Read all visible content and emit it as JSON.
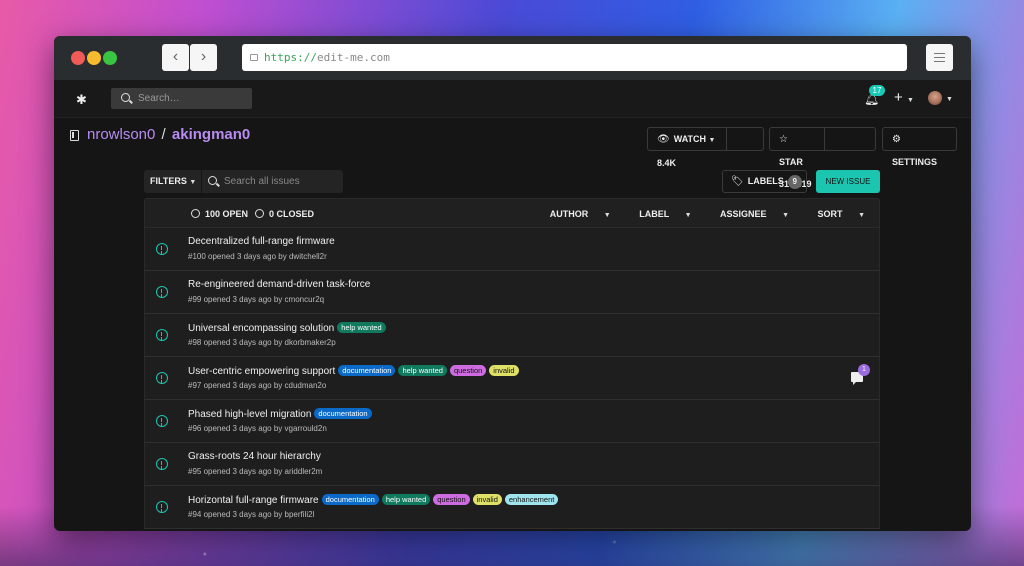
{
  "browser": {
    "url_protocol": "https://",
    "url_host": "edit-me.com",
    "back_glyph": "‹",
    "forward_glyph": "›"
  },
  "topnav": {
    "search_placeholder": "Search…",
    "notifications_count": "17",
    "plus": "+"
  },
  "repo": {
    "owner": "nrowlson0",
    "separator": "/",
    "name": "akingman0",
    "watch_label": "WATCH",
    "watch_count": "8.4K",
    "star_label": "STAR",
    "star_count": "316,419",
    "settings_label": "SETTINGS"
  },
  "toolbar": {
    "filters_label": "FILTERS",
    "search_placeholder": "Search all issues",
    "labels_label": "LABELS",
    "labels_count": "9",
    "new_issue_label": "NEW ISSUE"
  },
  "issues_header": {
    "open": "100 OPEN",
    "closed": "0 CLOSED",
    "author": "AUTHOR",
    "label": "LABEL",
    "assignee": "ASSIGNEE",
    "sort": "SORT"
  },
  "issues": [
    {
      "title": "Decentralized full-range firmware",
      "meta": "#100 opened 3 days ago by dwitchell2r",
      "labels": [],
      "comments": ""
    },
    {
      "title": "Re-engineered demand-driven task-force",
      "meta": "#99 opened 3 days ago by cmoncur2q",
      "labels": [],
      "comments": ""
    },
    {
      "title": "Universal encompassing solution",
      "meta": "#98 opened 3 days ago by dkorbmaker2p",
      "labels": [
        "help wanted"
      ],
      "comments": ""
    },
    {
      "title": "User-centric empowering support",
      "meta": "#97 opened 3 days ago by cdudman2o",
      "labels": [
        "documentation",
        "help wanted",
        "question",
        "invalid"
      ],
      "comments": "1"
    },
    {
      "title": "Phased high-level migration",
      "meta": "#96 opened 3 days ago by vgarrould2n",
      "labels": [
        "documentation"
      ],
      "comments": ""
    },
    {
      "title": "Grass-roots 24 hour hierarchy",
      "meta": "#95 opened 3 days ago by ariddler2m",
      "labels": [],
      "comments": ""
    },
    {
      "title": "Horizontal full-range firmware",
      "meta": "#94 opened 3 days ago by bperfili2l",
      "labels": [
        "documentation",
        "help wanted",
        "question",
        "invalid",
        "enhancement"
      ],
      "comments": ""
    }
  ],
  "colors": {
    "accent": "#1bc5b0",
    "repo_link": "#b78cf0",
    "label_documentation": "#0b69c7",
    "label_help_wanted": "#0f7a5e",
    "label_question": "#cf6be0",
    "label_invalid": "#dfe068",
    "label_enhancement": "#9ee4ef"
  }
}
